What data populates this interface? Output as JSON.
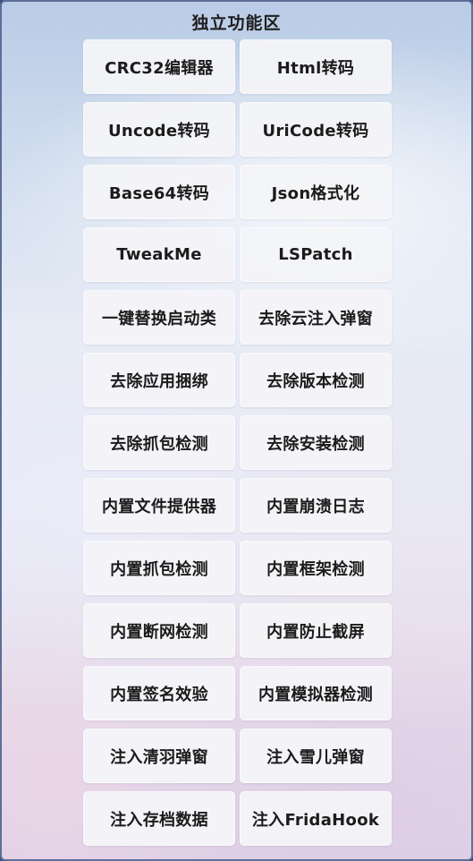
{
  "panel": {
    "title": "独立功能区"
  },
  "buttons": [
    {
      "label": "CRC32编辑器"
    },
    {
      "label": "Html转码"
    },
    {
      "label": "Uncode转码"
    },
    {
      "label": "UriCode转码"
    },
    {
      "label": "Base64转码"
    },
    {
      "label": "Json格式化"
    },
    {
      "label": "TweakMe"
    },
    {
      "label": "LSPatch"
    },
    {
      "label": "一键替换启动类"
    },
    {
      "label": "去除云注入弹窗"
    },
    {
      "label": "去除应用捆绑"
    },
    {
      "label": "去除版本检测"
    },
    {
      "label": "去除抓包检测"
    },
    {
      "label": "去除安装检测"
    },
    {
      "label": "内置文件提供器"
    },
    {
      "label": "内置崩溃日志"
    },
    {
      "label": "内置抓包检测"
    },
    {
      "label": "内置框架检测"
    },
    {
      "label": "内置断网检测"
    },
    {
      "label": "内置防止截屏"
    },
    {
      "label": "内置签名效验"
    },
    {
      "label": "内置模拟器检测"
    },
    {
      "label": "注入清羽弹窗"
    },
    {
      "label": "注入雪儿弹窗"
    },
    {
      "label": "注入存档数据"
    },
    {
      "label": "注入FridaHook"
    }
  ]
}
